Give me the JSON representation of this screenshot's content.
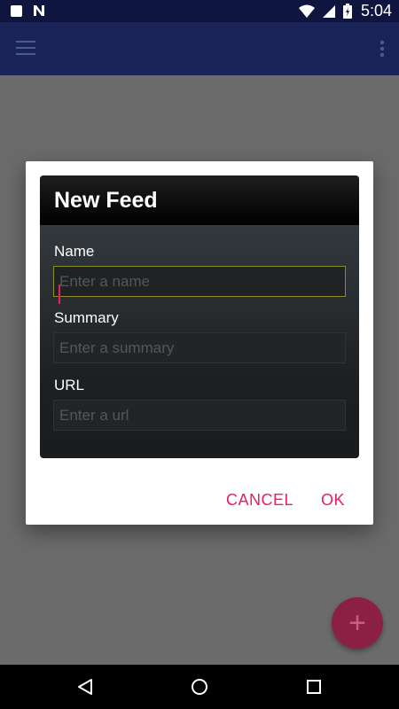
{
  "status_bar": {
    "time": "5:04"
  },
  "dialog": {
    "title": "New Feed",
    "fields": [
      {
        "label": "Name",
        "placeholder": "Enter a name"
      },
      {
        "label": "Summary",
        "placeholder": "Enter a summary"
      },
      {
        "label": "URL",
        "placeholder": "Enter a url"
      }
    ],
    "buttons": {
      "cancel": "CANCEL",
      "ok": "OK"
    }
  },
  "fab": {
    "symbol": "+"
  },
  "colors": {
    "accent": "#e91e63",
    "app_bar": "#1a2358",
    "status_bar": "#0e1640",
    "fab": "#8c1f44"
  },
  "icons": [
    "stop-icon",
    "n-icon",
    "wifi-icon",
    "signal-icon",
    "battery-icon",
    "menu-icon",
    "more-vert-icon",
    "back-icon",
    "home-icon",
    "recents-icon"
  ]
}
